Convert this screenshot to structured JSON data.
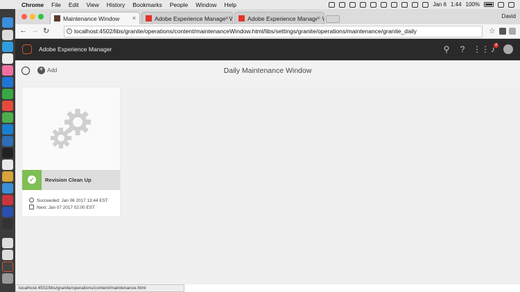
{
  "menubar": {
    "app": "Chrome",
    "items": [
      "File",
      "Edit",
      "View",
      "History",
      "Bookmarks",
      "People",
      "Window",
      "Help"
    ],
    "date": "Jan 6",
    "time": "1:44",
    "battery": "100%"
  },
  "browser": {
    "tabs": [
      {
        "title": "Maintenance Window",
        "active": true
      },
      {
        "title": "Adobe Experience Manager W",
        "active": false
      },
      {
        "title": "Adobe Experience Manager W",
        "active": false
      }
    ],
    "profile": "David",
    "url": "localhost:4502/libs/granite/operations/content/maintenanceWindow.html/libs/settings/granite/operations/maintenance/granite_daily",
    "status_url": "localhost:4502/libs/granite/operations/content/maintenance.html"
  },
  "aem": {
    "product": "Adobe Experience Manager",
    "notification_count": "4",
    "add_label": "Add",
    "page_title": "Daily Maintenance Window"
  },
  "card": {
    "title": "Revision Clean Up",
    "succeeded": "Succeeded: Jan 06 2017 13:44 EST",
    "next": "Next: Jan 07 2017 02:00 EST",
    "status_color": "#7fbe55"
  },
  "colors": {
    "aem_header": "#2a2a2a",
    "accent": "#c9562a",
    "success": "#7fbe55"
  }
}
